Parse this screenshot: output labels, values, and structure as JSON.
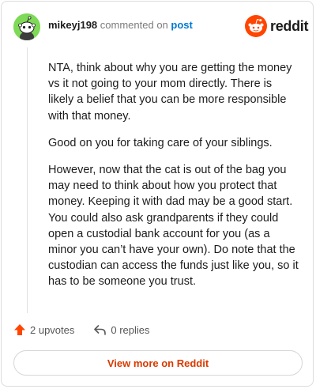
{
  "header": {
    "username": "mikeyj198",
    "commented_text": "commented on",
    "post_link": "post",
    "brand": "reddit"
  },
  "comment": {
    "paragraphs": [
      "NTA, think about why you are getting the money vs it not going to your mom directly. There is likely a belief that you can be more responsible with that money.",
      "Good on you for taking care of your siblings.",
      "However, now that the cat is out of the bag you may need to think about how you protect that money. Keeping it with dad may be a good start. You could also ask grandparents if they could open a custodial bank account for you (as a minor you can’t have your own). Do note that the custodian can access the funds just like you, so it has to be someone you trust."
    ]
  },
  "actions": {
    "upvotes": "2 upvotes",
    "replies": "0 replies"
  },
  "footer": {
    "view_more": "View more on Reddit"
  },
  "colors": {
    "brand_orange": "#ff4500",
    "link_blue": "#0079d3",
    "view_more_text": "#d93a00",
    "avatar_green": "#7ed957"
  },
  "icons": [
    "avatar-snoo-icon",
    "reddit-logo-icon",
    "upvote-arrow-icon",
    "reply-arrow-icon"
  ]
}
